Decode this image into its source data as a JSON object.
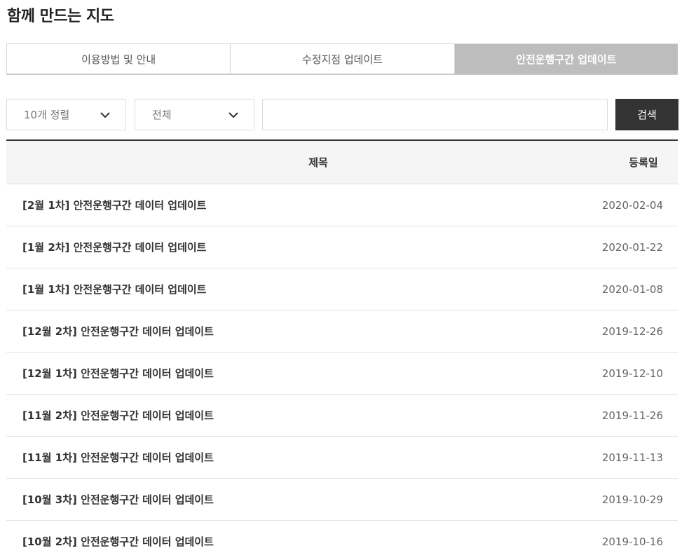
{
  "page": {
    "title": "함께 만드는 지도"
  },
  "tabs": [
    {
      "label": "이용방법 및 안내",
      "active": false
    },
    {
      "label": "수정지점 업데이트",
      "active": false
    },
    {
      "label": "안전운행구간 업데이트",
      "active": true
    }
  ],
  "search": {
    "sort_value": "10개 정렬",
    "filter_value": "전체",
    "query_value": "",
    "query_placeholder": "",
    "button_label": "검색"
  },
  "board": {
    "header": {
      "title": "제목",
      "date": "등록일"
    },
    "rows": [
      {
        "title": "[2월 1차] 안전운행구간 데이터 업데이트",
        "date": "2020-02-04"
      },
      {
        "title": "[1월 2차] 안전운행구간 데이터 업데이트",
        "date": "2020-01-22"
      },
      {
        "title": "[1월 1차] 안전운행구간 데이터 업데이트",
        "date": "2020-01-08"
      },
      {
        "title": "[12월 2차] 안전운행구간 데이터 업데이트",
        "date": "2019-12-26"
      },
      {
        "title": "[12월 1차] 안전운행구간 데이터 업데이트",
        "date": "2019-12-10"
      },
      {
        "title": "[11월 2차] 안전운행구간 데이터 업데이트",
        "date": "2019-11-26"
      },
      {
        "title": "[11월 1차] 안전운행구간 데이터 업데이트",
        "date": "2019-11-13"
      },
      {
        "title": "[10월 3차] 안전운행구간 데이터 업데이트",
        "date": "2019-10-29"
      },
      {
        "title": "[10월 2차] 안전운행구간 데이터 업데이트",
        "date": "2019-10-16"
      }
    ]
  },
  "icons": {
    "select_arrow": "chevron-down-icon"
  },
  "colors": {
    "active_tab": "#bdbdbd",
    "search_button": "#333333"
  }
}
